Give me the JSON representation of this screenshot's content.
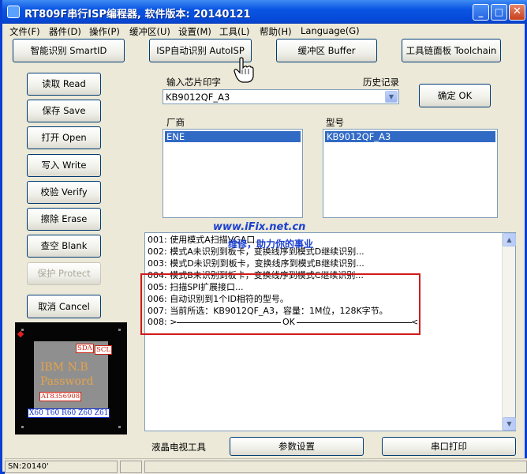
{
  "window": {
    "title": "RT809F串行ISP编程器, 软件版本: 20140121"
  },
  "title_buttons": {
    "minimize": "_",
    "maximize": "□",
    "close": "✕"
  },
  "menu": [
    "文件(F)",
    "器件(D)",
    "操作(P)",
    "缓冲区(U)",
    "设置(M)",
    "工具(L)",
    "帮助(H)",
    "Language(G)"
  ],
  "toolbar": {
    "smartid": "智能识别 SmartID",
    "autoisp": "ISP自动识别 AutoISP",
    "buffer": "缓冲区 Buffer",
    "toolchain": "工具链面板 Toolchain"
  },
  "left_buttons": [
    "读取 Read",
    "保存 Save",
    "打开 Open",
    "写入 Write",
    "校验 Verify",
    "擦除 Erase",
    "查空 Blank",
    "保护 Protect",
    "取消 Cancel"
  ],
  "chip_input": {
    "label": "输入芯片印字",
    "history_label": "历史记录",
    "value": "KB9012QF_A3"
  },
  "confirm_button": "确定 OK",
  "vendor": {
    "label": "厂商",
    "items": [
      "ENE"
    ]
  },
  "model": {
    "label": "型号",
    "items": [
      "KB9012QF_A3"
    ]
  },
  "log": [
    "001: 使用模式A扫描VGA口...",
    "002: 模式A未识别到板卡，变换线序到模式D继续识别...",
    "003: 模式D未识别到板卡，变换线序到模式B继续识别...",
    "004: 模式B未识别到板卡，变换线序到模式C继续识别...",
    "005: 扫描SPI扩展接口...",
    "006: 自动识别到1个ID相符的型号。",
    "007: 当前所选：KB9012QF_A3，容量：1M位，128K字节。",
    "008: >",
    "OK"
  ],
  "watermark": {
    "line1": "www.iFix.net.cn",
    "line2": "维修，助力你的事业"
  },
  "chip_image": {
    "sda": "SDA",
    "scl": "SCL",
    "line1": "IBM  N.B",
    "line2": "Password",
    "part": "AT8356908",
    "models": "X60 T60 R60 Z60 Z61"
  },
  "bottom": {
    "lcd_label": "液晶电视工具",
    "params_button": "参数设置",
    "serial_button": "串口打印"
  },
  "status": {
    "sn": "SN:20140'"
  },
  "colors": {
    "title_blue": "#0a55e3",
    "selection": "#316ac5",
    "highlight_red": "#d11a1a"
  }
}
